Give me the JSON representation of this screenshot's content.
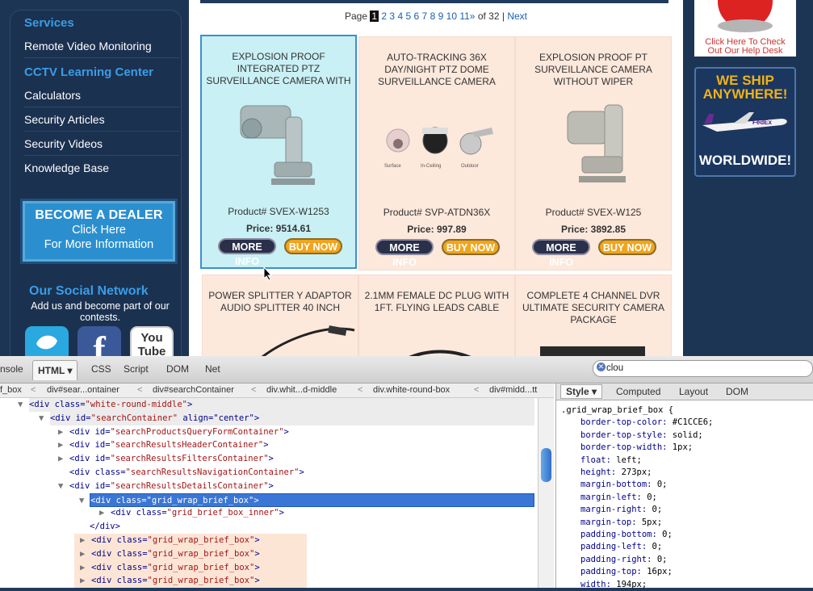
{
  "sidebar": {
    "services_heading": "Services",
    "remote_video": "Remote Video Monitoring",
    "learning_heading": "CCTV Learning Center",
    "calculators": "Calculators",
    "security_articles": "Security Articles",
    "security_videos": "Security Videos",
    "knowledge_base": "Knowledge Base",
    "dealer_line1": "BECOME A DEALER",
    "dealer_line2": "Click Here",
    "dealer_line3": "For More Information",
    "social_title": "Our Social Network",
    "social_sub": "Add us and become part of our contests.",
    "youtube_label": "You Tube"
  },
  "pager": {
    "prefix": "Page",
    "current": "1",
    "pages": [
      "2",
      "3",
      "4",
      "5",
      "6",
      "7",
      "8",
      "9",
      "10",
      "11»"
    ],
    "suffix": "of 32 |",
    "next": "Next"
  },
  "products": [
    {
      "title": "EXPLOSION PROOF INTEGRATED PTZ SURVEILLANCE CAMERA WITH",
      "sku": "Product# SVEX-W1253",
      "price": "Price: 9514.61",
      "info": "MORE INFO",
      "buy": "BUY NOW"
    },
    {
      "title": "AUTO-TRACKING 36X DAY/NIGHT PTZ DOME SURVEILLANCE CAMERA",
      "sku": "Product# SVP-ATDN36X",
      "price": "Price: 997.89",
      "info": "MORE INFO",
      "buy": "BUY NOW",
      "dome_labels": [
        "Surface",
        "In-Ceiling",
        "Outdoor"
      ]
    },
    {
      "title": "EXPLOSION PROOF PT SURVEILLANCE CAMERA WITHOUT WIPER",
      "sku": "Product# SVEX-W125",
      "price": "Price: 3892.85",
      "info": "MORE INFO",
      "buy": "BUY NOW"
    },
    {
      "title": "POWER SPLITTER Y ADAPTOR AUDIO SPLITTER 40 INCH"
    },
    {
      "title": "2.1MM FEMALE DC PLUG WITH 1FT. FLYING LEADS CABLE"
    },
    {
      "title": "COMPLETE 4 CHANNEL DVR ULTIMATE SECURITY CAMERA PACKAGE"
    }
  ],
  "rightbar": {
    "help_line1": "Click Here To Check",
    "help_line2": "Out Our Help Desk",
    "ship_line1": "WE SHIP",
    "ship_line2": "ANYWHERE!",
    "ship_line3": "WORLDWIDE!",
    "fedex": "FedEx"
  },
  "devtools": {
    "tabs": [
      "nsole",
      "HTML ▾",
      "CSS",
      "Script",
      "DOM",
      "Net"
    ],
    "search_value": "clou",
    "breadcrumbs": [
      "f_box",
      "div#sear...ontainer",
      "div#searchContainer",
      "div.whit...d-middle",
      "div.white-round-box",
      "div#midd...tt"
    ],
    "side_tabs": [
      "Style ▾",
      "Computed",
      "Layout",
      "DOM"
    ],
    "css_selector": ".grid_wrap_brief_box {",
    "css_props": [
      [
        "border-top-color:",
        "#C1CCE6;"
      ],
      [
        "border-top-style:",
        "solid;"
      ],
      [
        "border-top-width:",
        "1px;"
      ],
      [
        "float:",
        "left;"
      ],
      [
        "height:",
        "273px;"
      ],
      [
        "margin-bottom:",
        "0;"
      ],
      [
        "margin-left:",
        "0;"
      ],
      [
        "margin-right:",
        "0;"
      ],
      [
        "margin-top:",
        "5px;"
      ],
      [
        "padding-bottom:",
        "0;"
      ],
      [
        "padding-left:",
        "0;"
      ],
      [
        "padding-right:",
        "0;"
      ],
      [
        "padding-top:",
        "16px;"
      ],
      [
        "width:",
        "194px;"
      ]
    ],
    "tree": [
      {
        "tag": "div",
        "attr": "class",
        "val": "white-round-middle"
      },
      {
        "tag": "div",
        "attr": "id",
        "val": "searchContainer",
        "extra": " align=\"center\""
      },
      {
        "tag": "div",
        "attr": "id",
        "val": "searchProductsQueryFormContainer"
      },
      {
        "tag": "div",
        "attr": "id",
        "val": "searchResultsHeaderContainer"
      },
      {
        "tag": "div",
        "attr": "id",
        "val": "searchResultsFiltersContainer"
      },
      {
        "tag": "div",
        "attr": "class",
        "val": "searchResultsNavigationContainer"
      },
      {
        "tag": "div",
        "attr": "id",
        "val": "searchResultsDetailsContainer"
      },
      {
        "tag": "div",
        "attr": "class",
        "val": "grid_wrap_brief_box"
      },
      {
        "tag": "div",
        "attr": "class",
        "val": "grid_brief_box_inner"
      },
      {
        "close": "</div>"
      },
      {
        "tag": "div",
        "attr": "class",
        "val": "grid_wrap_brief_box"
      },
      {
        "tag": "div",
        "attr": "class",
        "val": "grid_wrap_brief_box"
      },
      {
        "tag": "div",
        "attr": "class",
        "val": "grid_wrap_brief_box"
      },
      {
        "tag": "div",
        "attr": "class",
        "val": "grid_wrap_brief_box"
      }
    ]
  }
}
